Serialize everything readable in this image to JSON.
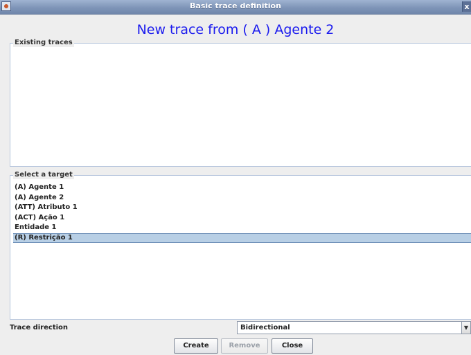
{
  "window": {
    "title": "Basic trace definition",
    "close_glyph": "x",
    "icon": "java-cup-icon"
  },
  "heading": "New trace from ( A ) Agente 2",
  "existing_traces": {
    "label": "Existing traces",
    "items": []
  },
  "target": {
    "label": "Select a target",
    "items": [
      {
        "label": "(A) Agente 1"
      },
      {
        "label": "(A) Agente 2"
      },
      {
        "label": "(ATT) Atributo 1"
      },
      {
        "label": "(ACT) Ação 1"
      },
      {
        "label": "Entidade 1"
      },
      {
        "label": "(R) Restrição 1",
        "selected": true
      }
    ]
  },
  "direction": {
    "label": "Trace direction",
    "value": "Bidirectional",
    "arrow_glyph": "▼"
  },
  "buttons": {
    "create": "Create",
    "remove": "Remove",
    "close": "Close"
  },
  "colors": {
    "heading": "#1a1aee",
    "selection": "#b8cfe5",
    "titlebar": "#7f95b8"
  }
}
